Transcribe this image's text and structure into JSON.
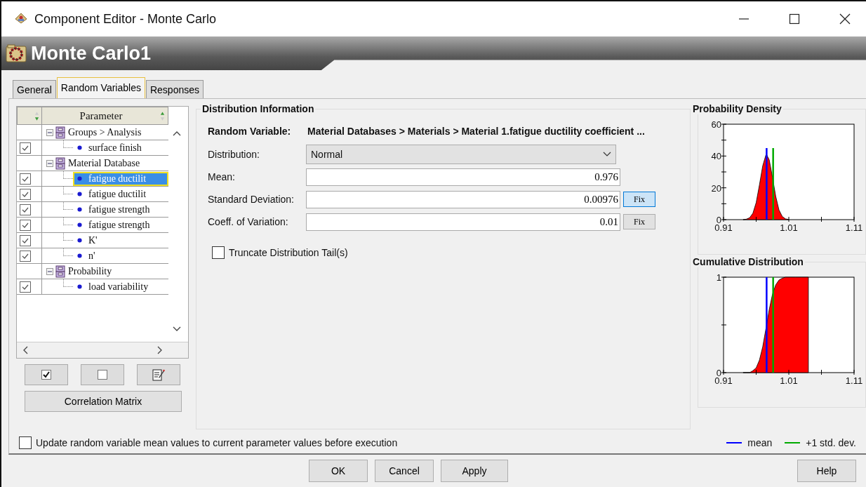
{
  "window": {
    "title": "Component Editor - Monte Carlo"
  },
  "header": {
    "title": "Monte Carlo1"
  },
  "tabs": [
    {
      "label": "General",
      "selected": false
    },
    {
      "label": "Random Variables",
      "selected": true
    },
    {
      "label": "Responses",
      "selected": false
    }
  ],
  "parameter_table": {
    "column": "Parameter",
    "groups": [
      {
        "label": "Groups > Analysis",
        "expanded": true,
        "children": [
          {
            "label": "surface finish",
            "checked": true,
            "selected": false
          }
        ]
      },
      {
        "label": "Material Database",
        "expanded": true,
        "children": [
          {
            "label": "fatigue ductilit",
            "checked": true,
            "selected": true
          },
          {
            "label": "fatigue ductilit",
            "checked": true,
            "selected": false
          },
          {
            "label": "fatigue strength",
            "checked": true,
            "selected": false
          },
          {
            "label": "fatigue strength",
            "checked": true,
            "selected": false
          },
          {
            "label": "K'",
            "checked": true,
            "selected": false
          },
          {
            "label": "n'",
            "checked": true,
            "selected": false
          }
        ]
      },
      {
        "label": "Probability",
        "expanded": true,
        "children": [
          {
            "label": "load variability",
            "checked": true,
            "selected": false
          }
        ]
      }
    ]
  },
  "correlation_button": "Correlation Matrix",
  "distribution": {
    "title": "Distribution Information",
    "variable_label": "Random Variable:",
    "variable": "Material Databases > Materials > Material 1.fatigue ductility coefficient ...",
    "fields": [
      {
        "label": "Distribution:",
        "kind": "select",
        "value": "Normal"
      },
      {
        "label": "Mean:",
        "kind": "input",
        "value": "0.976"
      },
      {
        "label": "Standard Deviation:",
        "kind": "input",
        "value": "0.00976",
        "fix": {
          "label": "Fix",
          "highlighted": true
        }
      },
      {
        "label": "Coeff. of Variation:",
        "kind": "input",
        "value": "0.01",
        "fix": {
          "label": "Fix",
          "highlighted": false
        }
      }
    ],
    "truncate": {
      "label": "Truncate Distribution Tail(s)",
      "checked": false
    }
  },
  "charts": [
    {
      "title": "Probability Density",
      "chart_data": {
        "type": "area",
        "x": [
          0.94,
          0.945,
          0.95,
          0.955,
          0.96,
          0.965,
          0.97,
          0.975,
          0.976,
          0.98,
          0.985,
          0.99,
          0.995,
          1.0,
          1.005,
          1.01
        ],
        "series": [
          {
            "color": "#ff0000",
            "values": [
              0,
              0.3,
              1.2,
              4,
              10.7,
              21.7,
              33.8,
              40.7,
              40.9,
              37.6,
              26.7,
              14.6,
              6.1,
              2,
              0.5,
              0.1
            ]
          }
        ],
        "xlim": [
          0.91,
          1.11
        ],
        "ylim": [
          0,
          60
        ],
        "xticks": [
          0.91,
          1.01,
          1.11
        ],
        "yticks": [
          0,
          20,
          40,
          60
        ],
        "ref_lines": [
          {
            "axis": "x",
            "value": 0.976,
            "color": "#0000ff"
          },
          {
            "axis": "x",
            "value": 0.986,
            "color": "#00aa00"
          }
        ]
      }
    },
    {
      "title": "Cumulative Distribution",
      "chart_data": {
        "type": "area",
        "x": [
          0.94,
          0.945,
          0.95,
          0.955,
          0.96,
          0.965,
          0.97,
          0.975,
          0.976,
          0.98,
          0.985,
          0.99,
          0.995,
          1.0,
          1.005,
          1.01,
          1.02,
          1.03,
          1.04
        ],
        "series": [
          {
            "color": "#ff0000",
            "values": [
              0,
              0,
              0,
              0.02,
              0.05,
              0.13,
              0.27,
              0.46,
              0.5,
              0.66,
              0.82,
              0.92,
              0.97,
              0.99,
              1,
              1,
              1,
              1,
              1
            ]
          }
        ],
        "xlim": [
          0.91,
          1.11
        ],
        "ylim": [
          0,
          1
        ],
        "xticks": [
          0.91,
          1.01,
          1.11
        ],
        "yticks": [
          0,
          1
        ],
        "ref_lines": [
          {
            "axis": "x",
            "value": 0.976,
            "color": "#0000ff"
          },
          {
            "axis": "x",
            "value": 0.986,
            "color": "#00aa00"
          }
        ]
      }
    }
  ],
  "update_option": {
    "label": "Update random variable mean values to current parameter values before execution",
    "checked": false
  },
  "legend": [
    {
      "label": "mean",
      "color": "#0000ff"
    },
    {
      "label": "+1 std. dev.",
      "color": "#00aa00"
    }
  ],
  "buttons": [
    "OK",
    "Cancel",
    "Apply"
  ],
  "help_button": "Help"
}
